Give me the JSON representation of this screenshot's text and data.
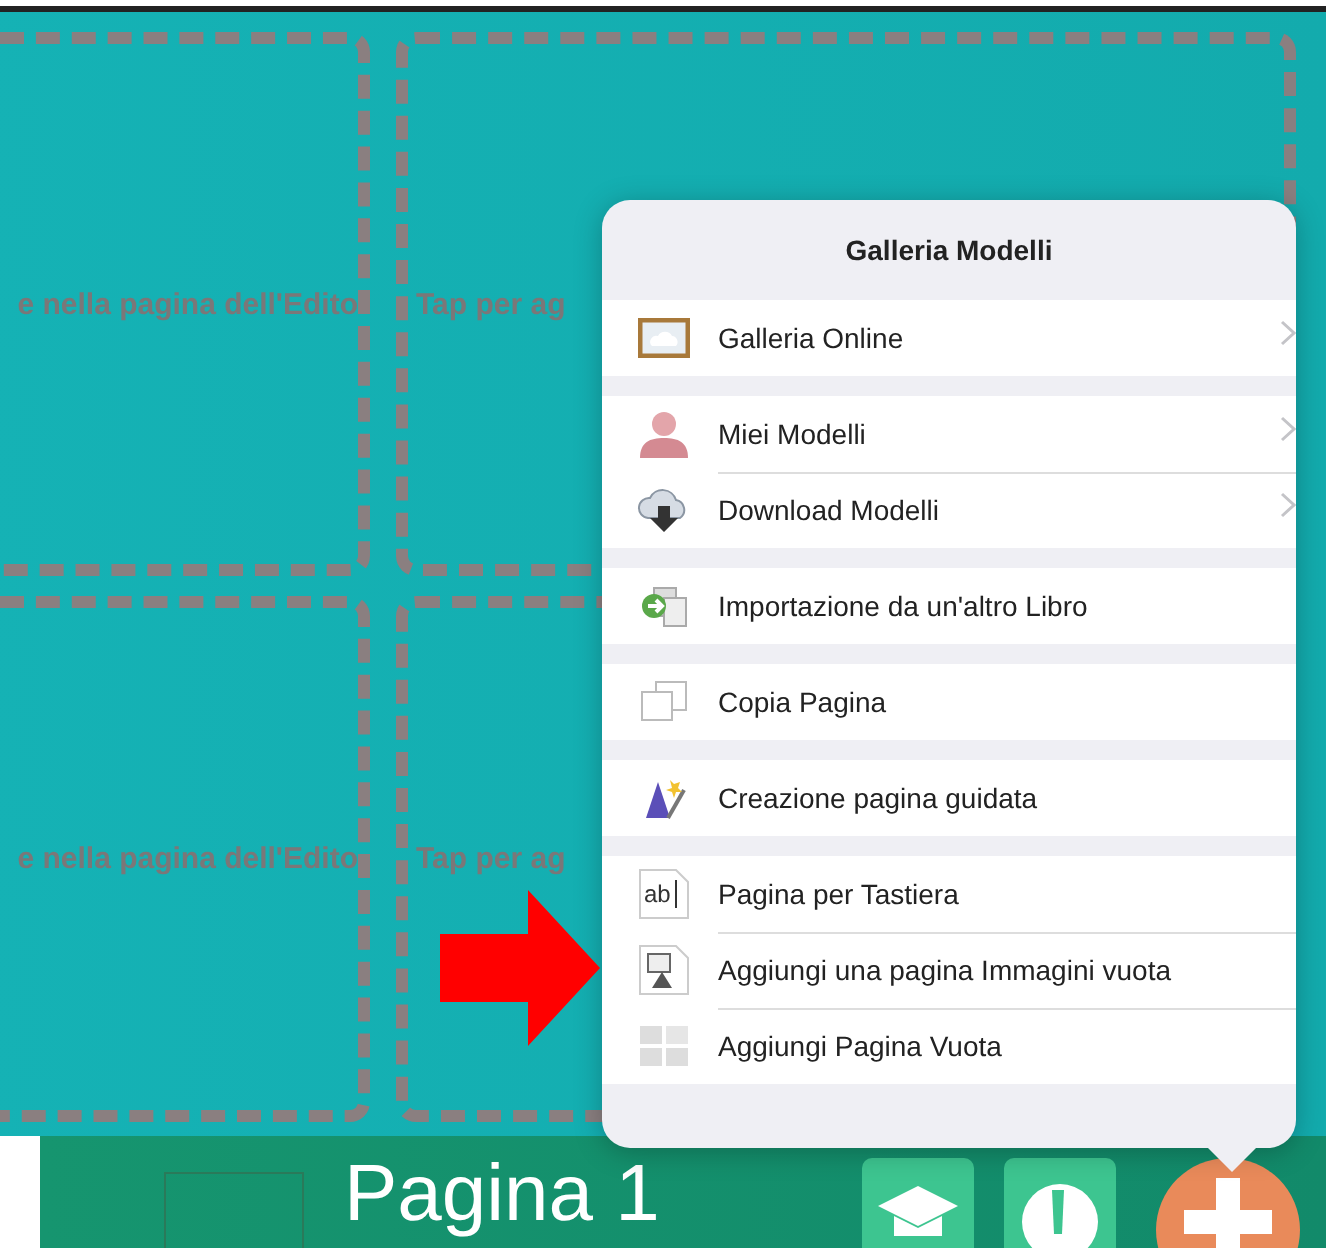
{
  "canvas": {
    "cells": [
      {
        "text": "e nella pagina dell'Edito"
      },
      {
        "text": "Tap per ag"
      },
      {
        "text": "e nella pagina dell'Edito"
      },
      {
        "text": "Tap per ag"
      }
    ]
  },
  "popover": {
    "title": "Galleria Modelli",
    "sections": [
      {
        "items": [
          {
            "label": "Galleria Online",
            "kind": "frame",
            "submenu": true
          }
        ]
      },
      {
        "items": [
          {
            "label": "Miei Modelli",
            "kind": "person",
            "submenu": true
          },
          {
            "label": "Download Modelli",
            "kind": "cloud",
            "submenu": true
          }
        ]
      },
      {
        "items": [
          {
            "label": "Importazione da un'altro Libro",
            "kind": "import",
            "submenu": false
          }
        ]
      },
      {
        "items": [
          {
            "label": "Copia Pagina",
            "kind": "copy",
            "submenu": false
          }
        ]
      },
      {
        "items": [
          {
            "label": "Creazione pagina guidata",
            "kind": "wizard",
            "submenu": false
          }
        ]
      },
      {
        "items": [
          {
            "label": "Pagina per Tastiera",
            "kind": "keyboard",
            "icon_text": "ab",
            "submenu": false
          },
          {
            "label": "Aggiungi una pagina Immagini vuota",
            "kind": "image",
            "submenu": false
          },
          {
            "label": "Aggiungi Pagina Vuota",
            "kind": "blank",
            "submenu": false
          }
        ]
      }
    ]
  },
  "bottom_bar": {
    "page_title": "Pagina 1"
  }
}
